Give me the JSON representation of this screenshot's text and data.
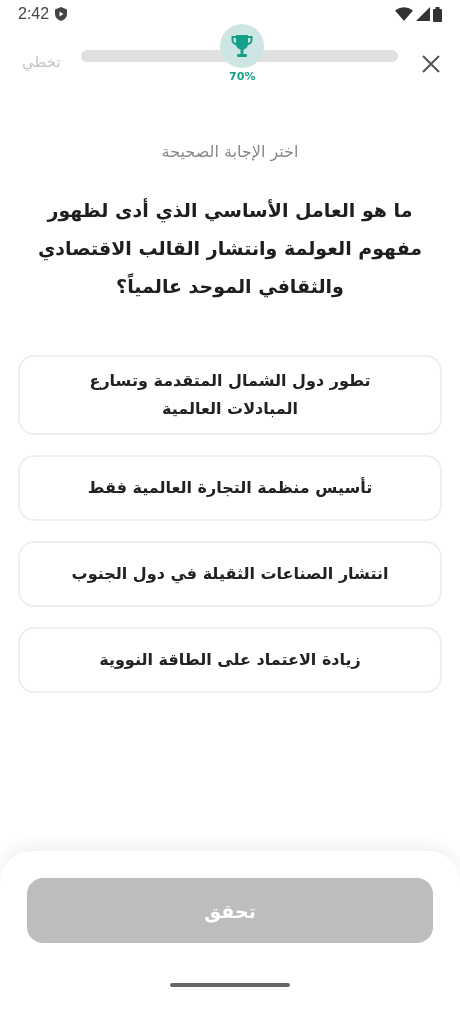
{
  "status_bar": {
    "time": "2:42"
  },
  "header": {
    "skip_label": "تخطي",
    "goal_label": "70%"
  },
  "instruction": "اختر الإجابة الصحيحة",
  "question": "ما هو العامل الأساسي الذي أدى لظهور مفهوم العولمة وانتشار القالب الاقتصادي والثقافي الموحد عالمياً؟",
  "options": [
    {
      "label": "تطور دول الشمال المتقدمة وتسارع المبادلات العالمية",
      "selected": false
    },
    {
      "label": "تأسيس منظمة التجارة العالمية فقط",
      "selected": false
    },
    {
      "label": "انتشار الصناعات الثقيلة في دول الجنوب",
      "selected": false
    },
    {
      "label": "زيادة الاعتماد على الطاقة النووية",
      "selected": false
    }
  ],
  "verify_button": {
    "label": "تحقق",
    "disabled": true
  }
}
